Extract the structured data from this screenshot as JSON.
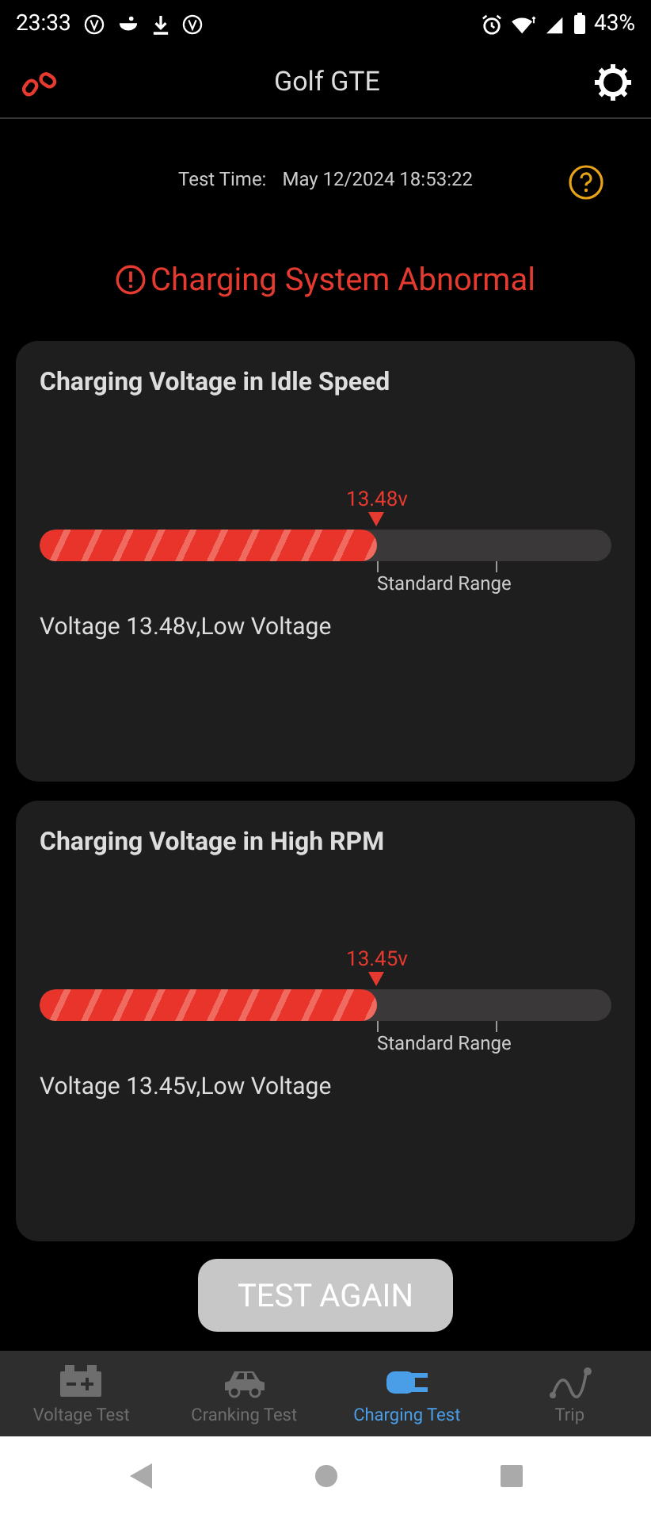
{
  "status_bar": {
    "time": "23:33",
    "battery": "43%"
  },
  "header": {
    "title": "Golf GTE"
  },
  "test_time": {
    "label": "Test Time:",
    "value": "May 12/2024 18:53:22"
  },
  "alert": {
    "text": "Charging System Abnormal"
  },
  "cards": [
    {
      "title": "Charging Voltage in Idle Speed",
      "level": 0.59,
      "reading": "13.48v",
      "range_label": "Standard Range",
      "result": "Voltage 13.48v,Low Voltage"
    },
    {
      "title": "Charging Voltage in High RPM",
      "level": 0.59,
      "reading": "13.45v",
      "range_label": "Standard Range",
      "result": "Voltage 13.45v,Low Voltage"
    }
  ],
  "button": "TEST AGAIN",
  "tabs": [
    {
      "label": "Voltage Test",
      "kind": "battery",
      "selected": false
    },
    {
      "label": "Cranking Test",
      "kind": "car",
      "selected": false
    },
    {
      "label": "Charging Test",
      "kind": "plug",
      "selected": true
    },
    {
      "label": "Trip",
      "kind": "trip",
      "selected": false
    }
  ]
}
